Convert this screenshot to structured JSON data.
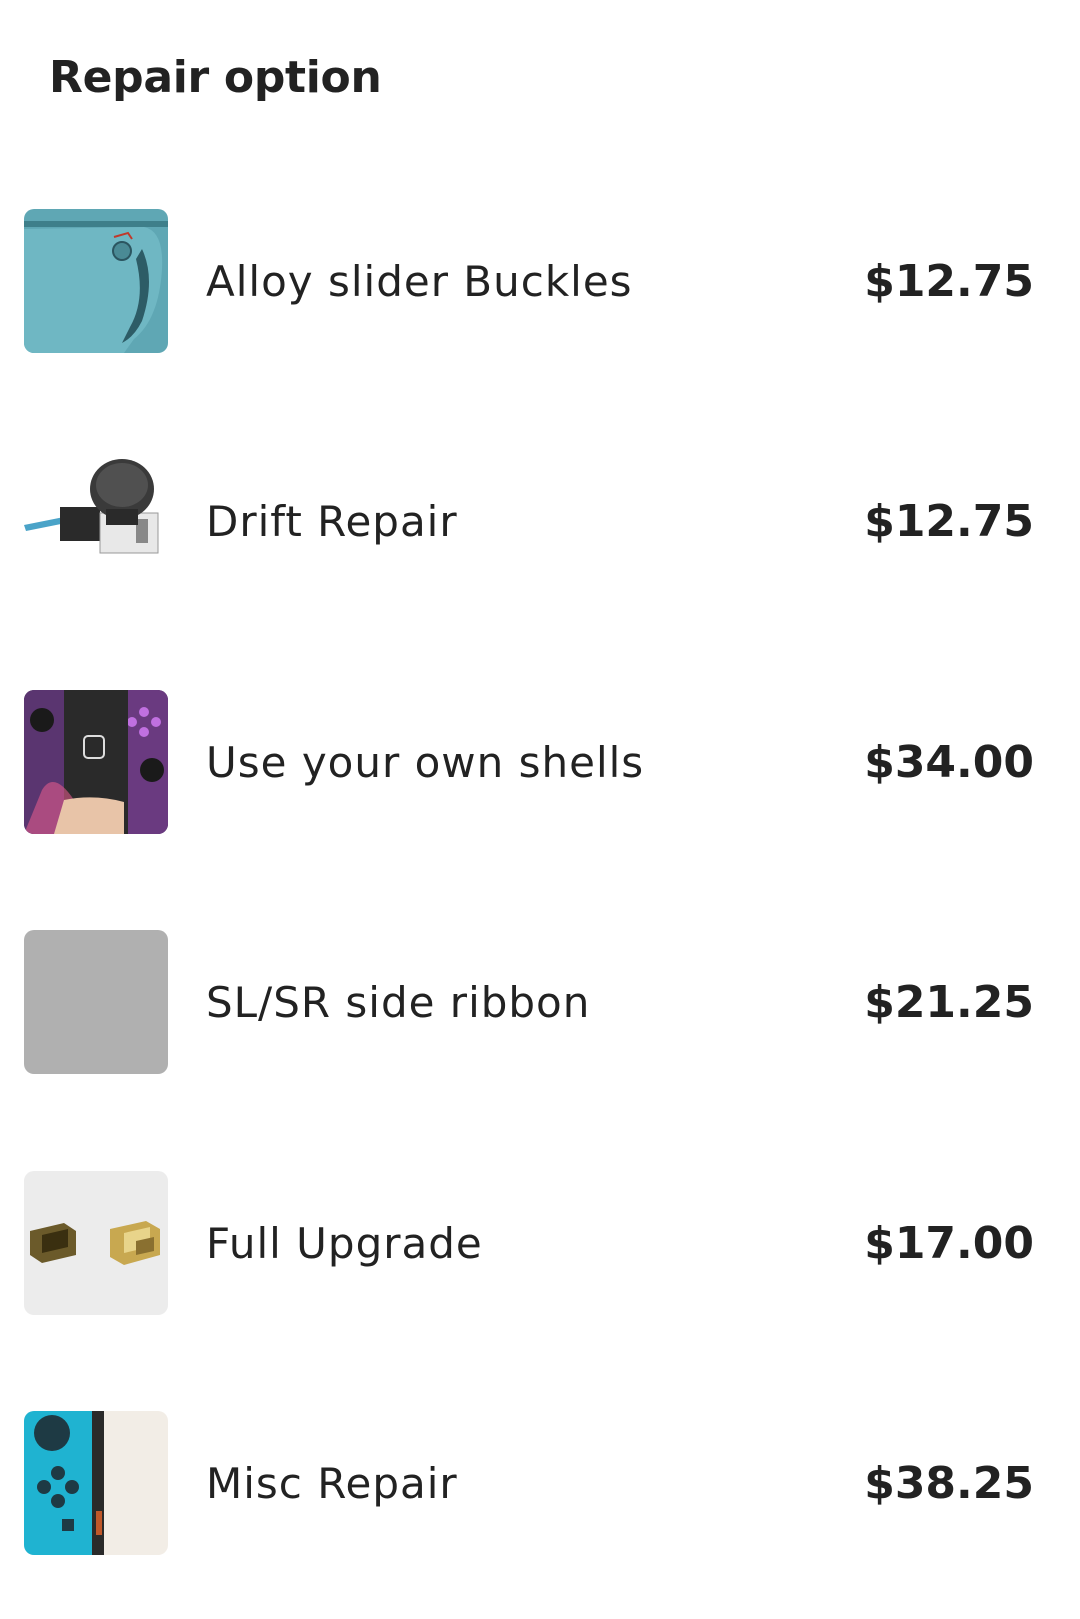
{
  "header": {
    "title": "Repair option"
  },
  "options": [
    {
      "name": "Alloy slider Buckles",
      "price": "$12.75",
      "icon": "joycon-rail-icon"
    },
    {
      "name": "Drift Repair",
      "price": "$12.75",
      "icon": "analog-stick-icon"
    },
    {
      "name": "Use your own shells",
      "price": "$34.00",
      "icon": "custom-shell-controller-icon"
    },
    {
      "name": "SL/SR side ribbon",
      "price": "$21.25",
      "icon": "placeholder-image-icon"
    },
    {
      "name": "Full Upgrade",
      "price": "$17.00",
      "icon": "metal-buckle-parts-icon"
    },
    {
      "name": "Misc Repair",
      "price": "$38.25",
      "icon": "joycon-buttons-icon"
    }
  ],
  "colors": {
    "text": "#222222",
    "placeholder": "#b0b0b0",
    "background": "#ffffff"
  }
}
